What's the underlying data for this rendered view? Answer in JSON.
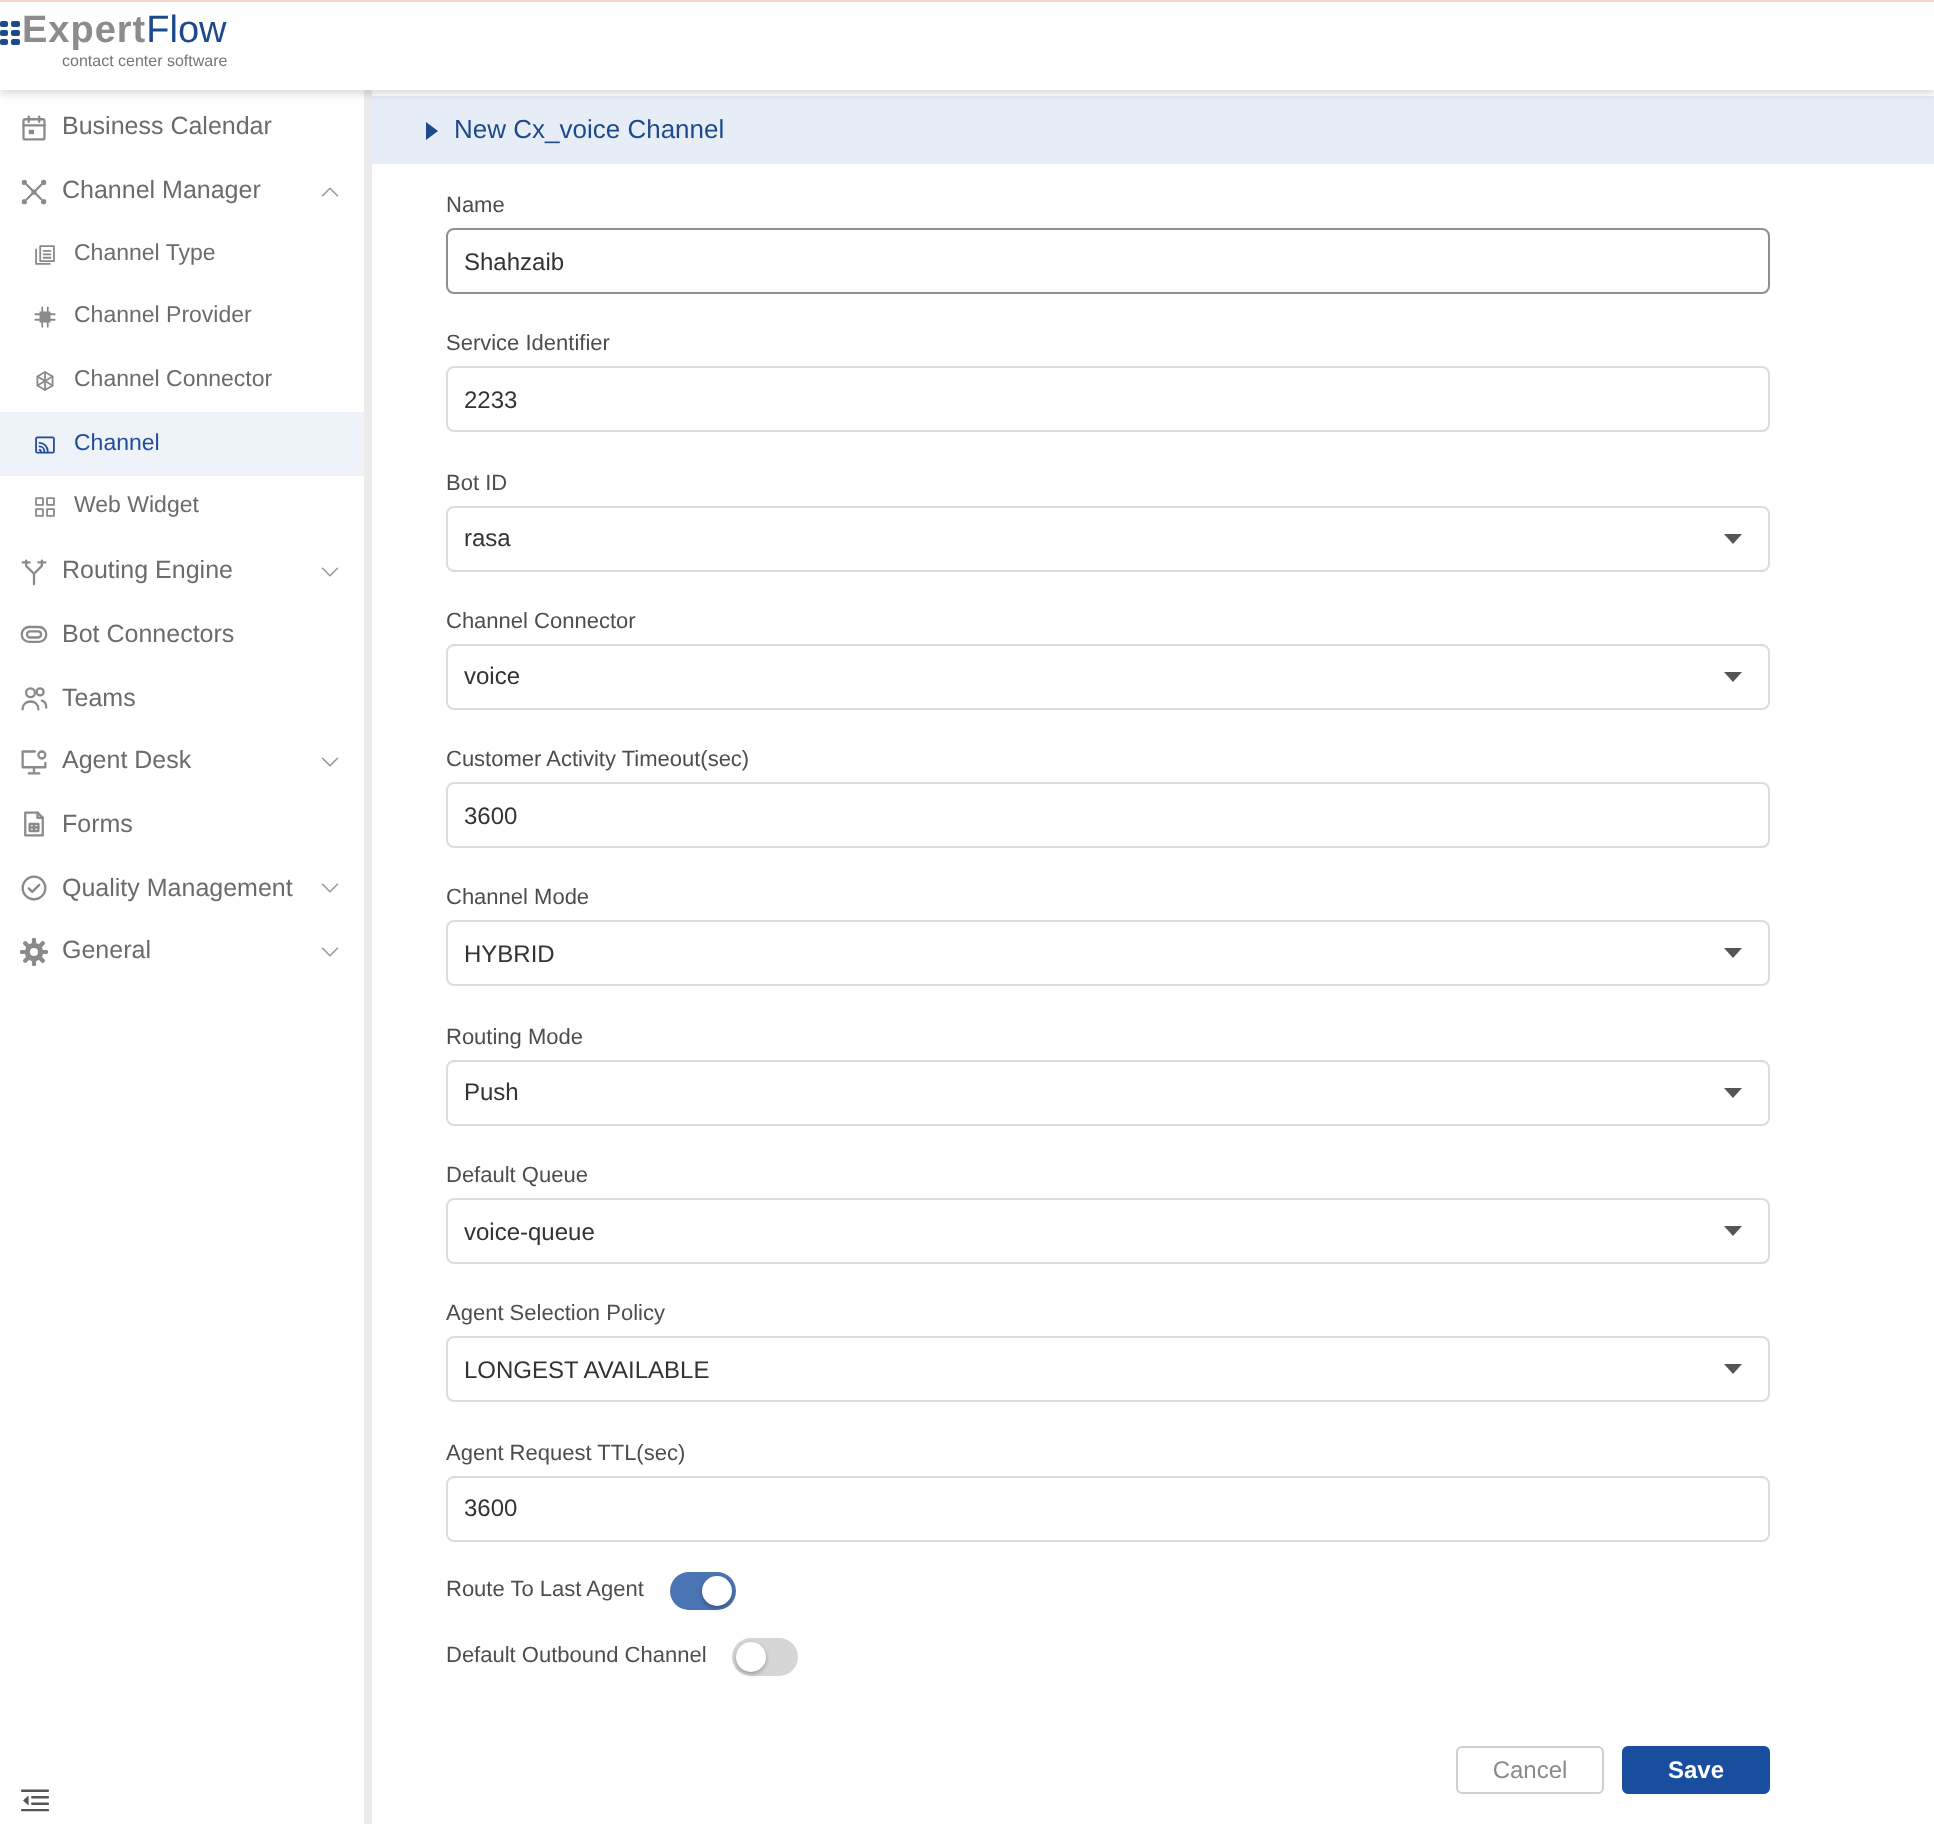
{
  "header": {
    "logo": {
      "name_part_1": "Expert",
      "name_part_2": "Flow",
      "tagline": "contact center software"
    }
  },
  "sidebar": {
    "items": [
      {
        "label": "Business Calendar",
        "selected": false
      },
      {
        "label": "Channel Manager",
        "selected": false,
        "expanded": true,
        "children": [
          {
            "label": "Channel Type",
            "selected": false
          },
          {
            "label": "Channel Provider",
            "selected": false
          },
          {
            "label": "Channel Connector",
            "selected": false
          },
          {
            "label": "Channel",
            "selected": true
          },
          {
            "label": "Web Widget",
            "selected": false
          }
        ]
      },
      {
        "label": "Routing Engine",
        "selected": false,
        "expanded": false
      },
      {
        "label": "Bot Connectors",
        "selected": false
      },
      {
        "label": "Teams",
        "selected": false
      },
      {
        "label": "Agent Desk",
        "selected": false,
        "expanded": false
      },
      {
        "label": "Forms",
        "selected": false
      },
      {
        "label": "Quality Management",
        "selected": false,
        "expanded": false
      },
      {
        "label": "General",
        "selected": false,
        "expanded": false
      }
    ]
  },
  "panel": {
    "title": "New Cx_voice Channel"
  },
  "form": {
    "fields": [
      {
        "kind": "text",
        "label": "Name",
        "value": "Shahzaib",
        "focused": true
      },
      {
        "kind": "text",
        "label": "Service Identifier",
        "value": "2233",
        "focused": false
      },
      {
        "kind": "select",
        "label": "Bot ID",
        "value": "rasa",
        "focused": false
      },
      {
        "kind": "select",
        "label": "Channel Connector",
        "value": "voice",
        "focused": false
      },
      {
        "kind": "text",
        "label": "Customer Activity Timeout(sec)",
        "value": "3600",
        "focused": false
      },
      {
        "kind": "select",
        "label": "Channel Mode",
        "value": "HYBRID",
        "focused": false
      },
      {
        "kind": "select",
        "label": "Routing Mode",
        "value": "Push",
        "focused": false
      },
      {
        "kind": "select",
        "label": "Default Queue",
        "value": "voice-queue",
        "focused": false
      },
      {
        "kind": "select",
        "label": "Agent Selection Policy",
        "value": "LONGEST AVAILABLE",
        "focused": false
      },
      {
        "kind": "text",
        "label": "Agent Request TTL(sec)",
        "value": "3600",
        "focused": false
      }
    ],
    "toggles": [
      {
        "label": "Route To Last Agent",
        "on": true
      },
      {
        "label": "Default Outbound Channel",
        "on": false
      }
    ],
    "buttons": [
      {
        "kind": "secondary",
        "label": "Cancel"
      },
      {
        "kind": "primary",
        "label": "Save"
      }
    ]
  }
}
